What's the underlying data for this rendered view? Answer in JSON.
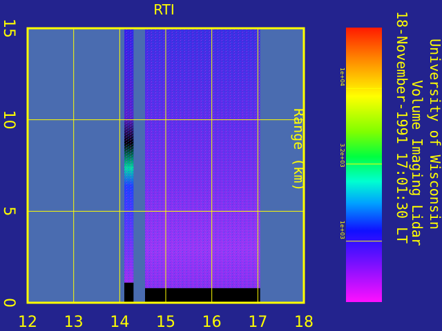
{
  "chart_data": {
    "type": "heatmap",
    "title": "RTI",
    "xlabel": "",
    "ylabel": "Range (km)",
    "xlim": [
      12,
      18
    ],
    "ylim": [
      0,
      15
    ],
    "x_ticks": [
      "12",
      "13",
      "14",
      "15",
      "16",
      "17",
      "18"
    ],
    "y_ticks": [
      "0",
      "5",
      "10",
      "15"
    ],
    "grid": true,
    "colorbar": {
      "ticks": [
        "1e+04",
        "3.2e+03",
        "1e+03"
      ],
      "tick_values": [
        10000,
        3200,
        1000
      ],
      "scale": "log"
    },
    "data_blocks": [
      {
        "x0": 14.1,
        "x1": 14.3,
        "ymin": 1.1,
        "ymax": 15
      },
      {
        "x0": 14.55,
        "x1": 17.05,
        "ymin": 0.8,
        "ymax": 15
      }
    ]
  },
  "caption": {
    "line1": "University of Wisconsin",
    "line2": "Volume Imaging Lidar",
    "line3": "18-November-1991 17:01:30 LT"
  },
  "colors": {
    "background": "#23238e",
    "plot_area": "#4a6cb0",
    "axis": "#ffff00"
  }
}
